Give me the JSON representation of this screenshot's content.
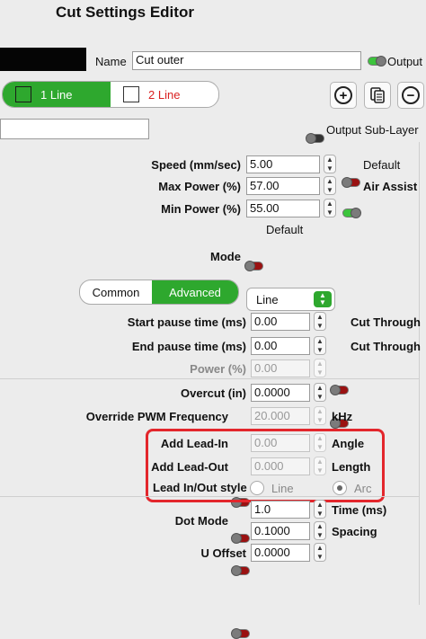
{
  "window": {
    "title": "Cut Settings Editor"
  },
  "name_row": {
    "label": "Name",
    "value": "Cut outer",
    "output_label": "Output"
  },
  "line_tabs": [
    {
      "label": "1 Line",
      "color": "#2ea82e",
      "selected": true
    },
    {
      "label": "2 Line",
      "color": "#d92020",
      "selected": false
    }
  ],
  "toolbar": {
    "add": "add-icon",
    "copy": "copy-icon",
    "remove": "remove-icon"
  },
  "sublayer": {
    "label": "Output Sub-Layer"
  },
  "speed": {
    "label": "Speed (mm/sec)",
    "value": "5.00",
    "default_label": "Default"
  },
  "max_power": {
    "label": "Max Power (%)",
    "value": "57.00",
    "air_assist_label": "Air Assist"
  },
  "min_power": {
    "label": "Min Power (%)",
    "value": "55.00"
  },
  "power_default": {
    "label": "Default"
  },
  "mode": {
    "label": "Mode",
    "value": "Line"
  },
  "mode_tabs": [
    {
      "label": "Common",
      "selected": false
    },
    {
      "label": "Advanced",
      "selected": true
    }
  ],
  "start_pause": {
    "label": "Start pause time (ms)",
    "value": "0.00",
    "cut_through_label": "Cut Through"
  },
  "end_pause": {
    "label": "End pause time (ms)",
    "value": "0.00",
    "cut_through_label": "Cut Through"
  },
  "power_pct": {
    "label": "Power (%)",
    "value": "0.00"
  },
  "overcut": {
    "label": "Overcut (in)",
    "value": "0.0000"
  },
  "pwm": {
    "label": "Override PWM Frequency",
    "value": "20.000",
    "unit": "kHz"
  },
  "lead_in": {
    "label": "Add Lead-In",
    "value": "0.00",
    "unit": "Angle"
  },
  "lead_out": {
    "label": "Add Lead-Out",
    "value": "0.000",
    "unit": "Length"
  },
  "lead_style": {
    "label": "Lead In/Out style",
    "options": [
      "Line",
      "Arc"
    ],
    "selected": "Arc"
  },
  "dot_mode": {
    "label": "Dot Mode",
    "time_value": "1.0",
    "time_unit": "Time (ms)",
    "spacing_value": "0.1000",
    "spacing_unit": "Spacing"
  },
  "u_offset": {
    "label": "U Offset",
    "value": "0.0000"
  },
  "colors": {
    "accent": "#2ea82e",
    "toggle_off": "#9a1111",
    "highlight": "#e3262c"
  }
}
